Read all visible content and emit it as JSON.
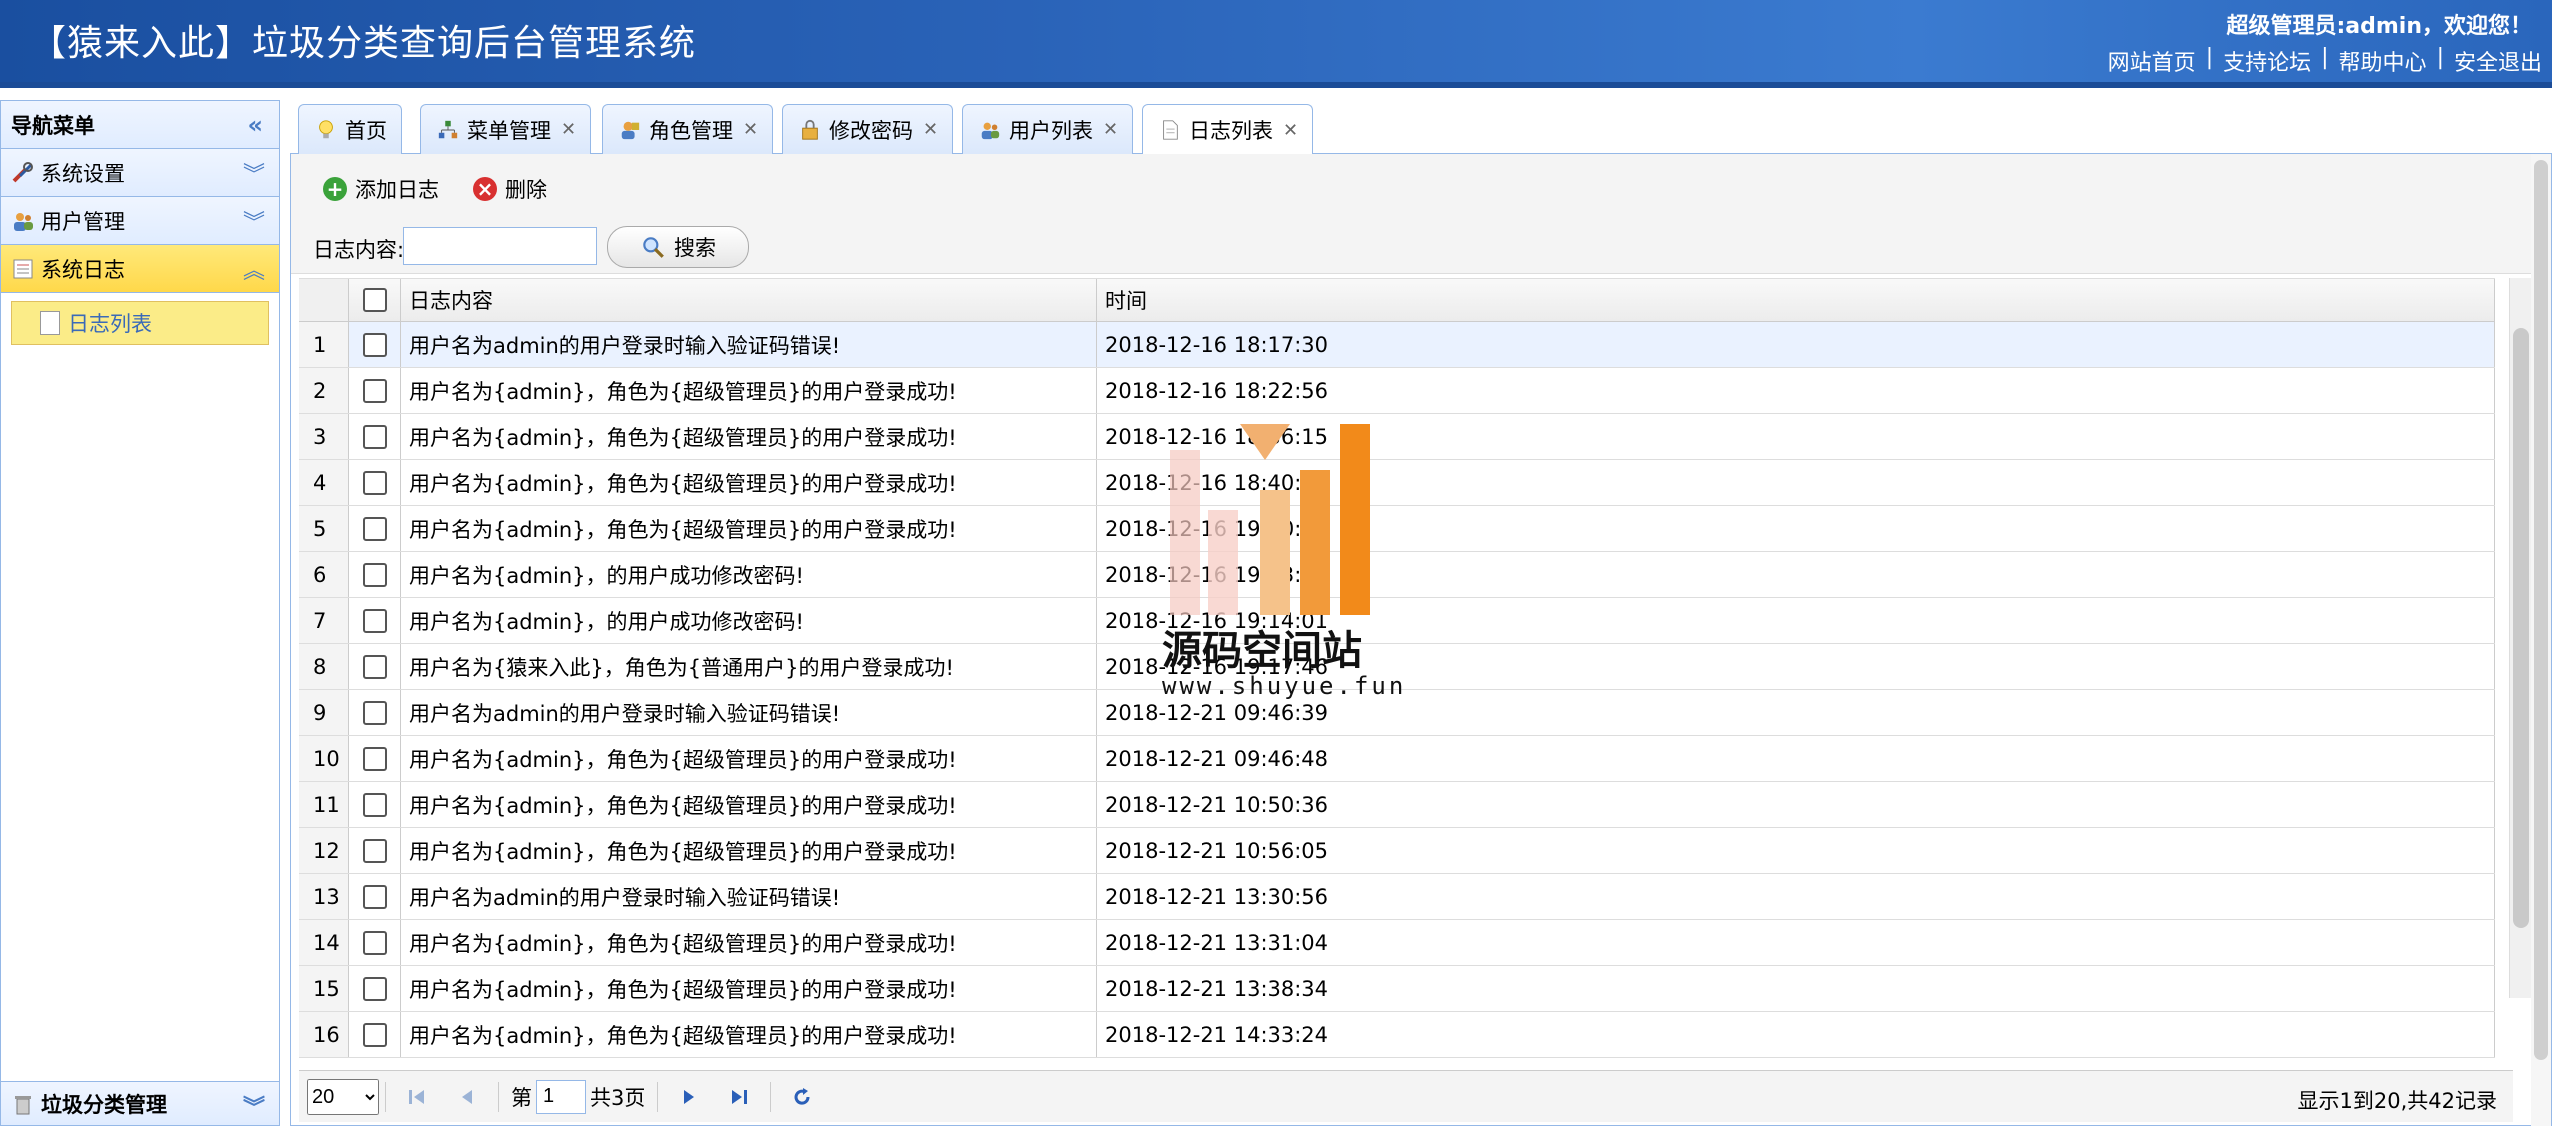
{
  "header": {
    "title": "【猿来入此】垃圾分类查询后台管理系统",
    "welcome": "超级管理员:admin，欢迎您！",
    "links": [
      "网站首页",
      "支持论坛",
      "帮助中心",
      "安全退出"
    ]
  },
  "sidebar": {
    "title": "导航菜单",
    "panels": [
      {
        "label": "系统设置",
        "icon": "tools-icon"
      },
      {
        "label": "用户管理",
        "icon": "users-icon"
      },
      {
        "label": "系统日志",
        "icon": "log-icon"
      }
    ],
    "sub_item": "日志列表",
    "bottom_panel": "垃圾分类管理"
  },
  "tabs": [
    {
      "label": "首页",
      "icon": "bulb-icon",
      "closable": false
    },
    {
      "label": "菜单管理",
      "icon": "tree-icon",
      "closable": true
    },
    {
      "label": "角色管理",
      "icon": "role-icon",
      "closable": true
    },
    {
      "label": "修改密码",
      "icon": "lock-icon",
      "closable": true
    },
    {
      "label": "用户列表",
      "icon": "users-icon",
      "closable": true
    },
    {
      "label": "日志列表",
      "icon": "doc-icon",
      "closable": true,
      "active": true
    }
  ],
  "toolbar": {
    "add_label": "添加日志",
    "delete_label": "删除",
    "search_label": "日志内容:",
    "search_value": "",
    "search_button": "搜索"
  },
  "grid": {
    "col_content": "日志内容",
    "col_time": "时间",
    "rows": [
      {
        "n": "1",
        "content": "用户名为admin的用户登录时输入验证码错误!",
        "time": "2018-12-16 18:17:30"
      },
      {
        "n": "2",
        "content": "用户名为{admin}，角色为{超级管理员}的用户登录成功!",
        "time": "2018-12-16 18:22:56"
      },
      {
        "n": "3",
        "content": "用户名为{admin}，角色为{超级管理员}的用户登录成功!",
        "time": "2018-12-16 18:36:15"
      },
      {
        "n": "4",
        "content": "用户名为{admin}，角色为{超级管理员}的用户登录成功!",
        "time": "2018-12-16 18:40:21"
      },
      {
        "n": "5",
        "content": "用户名为{admin}，角色为{超级管理员}的用户登录成功!",
        "time": "2018-12-16 19:10:24"
      },
      {
        "n": "6",
        "content": "用户名为{admin}，的用户成功修改密码!",
        "time": "2018-12-16 19:13:43"
      },
      {
        "n": "7",
        "content": "用户名为{admin}，的用户成功修改密码!",
        "time": "2018-12-16 19:14:01"
      },
      {
        "n": "8",
        "content": "用户名为{猿来入此}，角色为{普通用户}的用户登录成功!",
        "time": "2018-12-16 19:17:46"
      },
      {
        "n": "9",
        "content": "用户名为admin的用户登录时输入验证码错误!",
        "time": "2018-12-21 09:46:39"
      },
      {
        "n": "10",
        "content": "用户名为{admin}，角色为{超级管理员}的用户登录成功!",
        "time": "2018-12-21 09:46:48"
      },
      {
        "n": "11",
        "content": "用户名为{admin}，角色为{超级管理员}的用户登录成功!",
        "time": "2018-12-21 10:50:36"
      },
      {
        "n": "12",
        "content": "用户名为{admin}，角色为{超级管理员}的用户登录成功!",
        "time": "2018-12-21 10:56:05"
      },
      {
        "n": "13",
        "content": "用户名为admin的用户登录时输入验证码错误!",
        "time": "2018-12-21 13:30:56"
      },
      {
        "n": "14",
        "content": "用户名为{admin}，角色为{超级管理员}的用户登录成功!",
        "time": "2018-12-21 13:31:04"
      },
      {
        "n": "15",
        "content": "用户名为{admin}，角色为{超级管理员}的用户登录成功!",
        "time": "2018-12-21 13:38:34"
      },
      {
        "n": "16",
        "content": "用户名为{admin}，角色为{超级管理员}的用户登录成功!",
        "time": "2018-12-21 14:33:24"
      }
    ]
  },
  "pager": {
    "page_size": "20",
    "page_prefix": "第",
    "page_value": "1",
    "page_total": "共3页",
    "info": "显示1到20,共42记录"
  },
  "watermark": {
    "title": "源码空间站",
    "url": "www.shuyue.fun"
  },
  "colors": {
    "header": "#2a63b8",
    "panel_border": "#95b8e7",
    "active_panel": "#ffd84a",
    "watermark_orange": "#f28a1a"
  }
}
